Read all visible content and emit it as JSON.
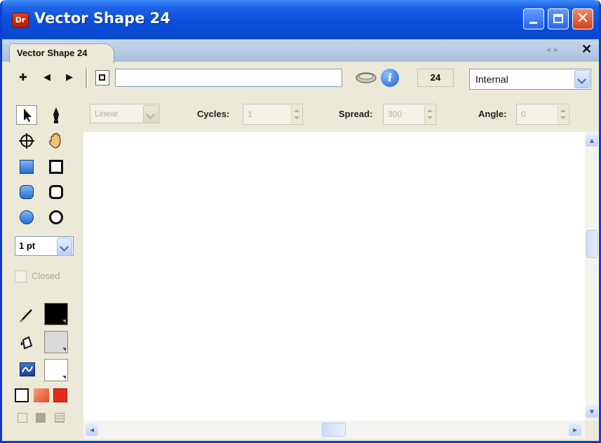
{
  "window": {
    "title": "Vector Shape 24",
    "app_icon_label": "Dr",
    "colors": {
      "titlebar": "#0a4fdc",
      "close": "#d2401a"
    }
  },
  "tab": {
    "label": "Vector Shape 24"
  },
  "toolbar": {
    "name_value": "",
    "count_value": "24",
    "link_type": "Internal",
    "icons": [
      "add-point-icon",
      "previous-icon",
      "next-icon",
      "shape-icon",
      "library-icon",
      "info-icon"
    ]
  },
  "tools": {
    "stroke_size": "1 pt",
    "closed_label": "Closed",
    "icons": [
      "pointer-icon",
      "pen-icon",
      "crosshair-icon",
      "hand-icon",
      "rectangle-filled-icon",
      "rectangle-icon",
      "rounded-rect-filled-icon",
      "rounded-rect-icon",
      "ellipse-filled-icon",
      "ellipse-icon",
      "stroke-color-icon",
      "fill-color-icon",
      "gradient-icon"
    ],
    "colors": {
      "stroke": "#000000",
      "fill": "#d9d9d9",
      "gradient": "#ffffff",
      "red": "#e32b1a",
      "orange": "#f08060"
    }
  },
  "options": {
    "gradient_type": "Linear",
    "cycles_label": "Cycles:",
    "cycles_value": "1",
    "spread_label": "Spread:",
    "spread_value": "300",
    "angle_label": "Angle:",
    "angle_value": "0"
  }
}
